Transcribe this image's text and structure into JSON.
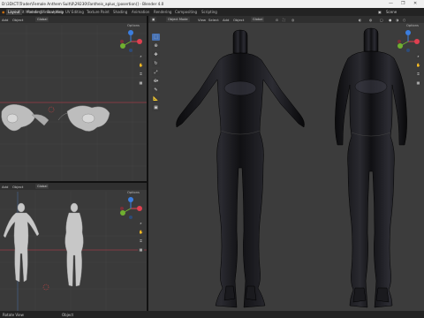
{
  "titlebar": {
    "title": "D:\\3D\\CT\\Trader\\Female Anthem Suit\\0\\29230\\Fantheis_aplus_(posertion)] - Blender 4.0",
    "window_controls": [
      "—",
      "❐",
      "✕"
    ]
  },
  "menubar": {
    "icon": "blender-icon",
    "menus": [
      "File",
      "Edit",
      "Render",
      "Window",
      "Help"
    ],
    "tabs": [
      "Layout",
      "Modeling",
      "Sculpting",
      "UV Editing",
      "Texture Paint",
      "Shading",
      "Animation",
      "Rendering",
      "Compositing",
      "Scripting"
    ],
    "active_tab": "Layout",
    "scene": "Scene"
  },
  "viewports": {
    "top_left": {
      "header": [
        "Add",
        "Object",
        "Global"
      ],
      "options": "Options"
    },
    "bottom_left": {
      "header": [
        "Add",
        "Object",
        "Global"
      ],
      "options": "Options"
    },
    "main": {
      "mode": "Object Mode",
      "header": [
        "View",
        "Select",
        "Add",
        "Object"
      ],
      "transform": "Global",
      "options": "Options"
    }
  },
  "statusbar": {
    "left": "Rotate View",
    "mid": "Object"
  },
  "colors": {
    "accent": "#4772b3",
    "x_axis": "#e04050",
    "y_axis": "#70b030",
    "z_axis": "#3b7ee0",
    "grid": "#3d3d3d"
  }
}
